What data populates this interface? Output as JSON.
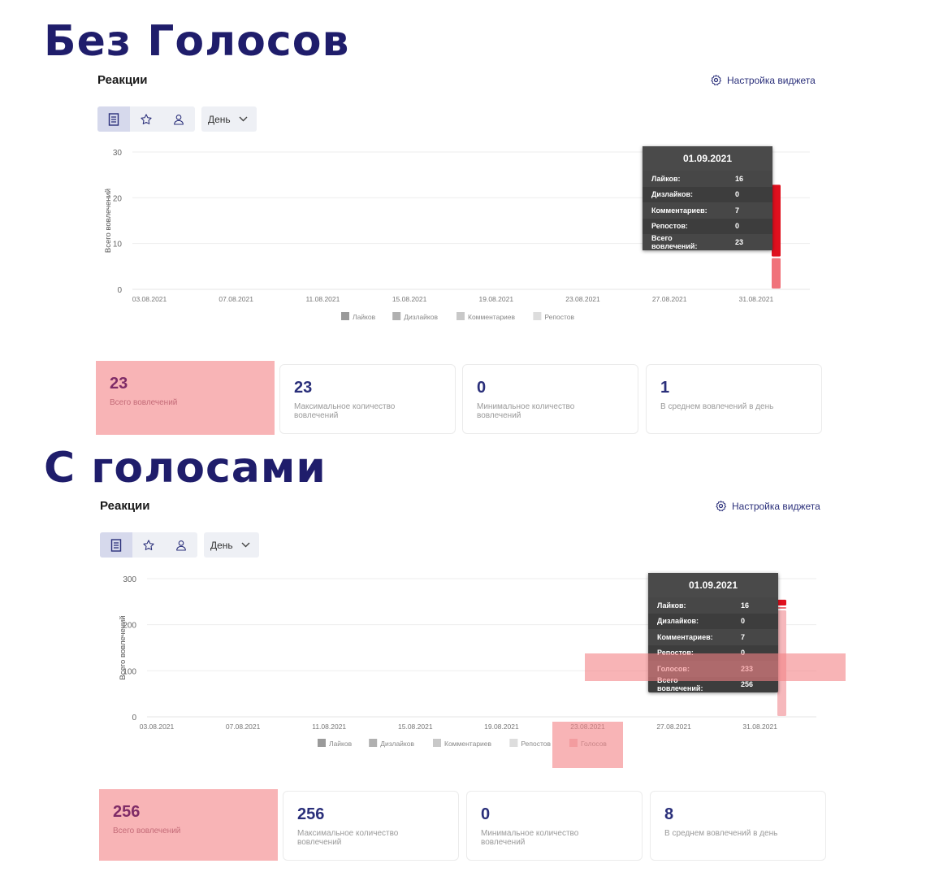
{
  "headings": {
    "without_votes": "Без Голосов",
    "with_votes": "С голосами"
  },
  "colors": {
    "heading": "#1f1d6b",
    "accent": "#2a2f7a",
    "bar_red": "#e0101e",
    "bar_pink": "#f0727a",
    "bar_light_pink": "#f6b8bc",
    "highlight": "#f38286"
  },
  "icons": {
    "settings": "gear-icon",
    "toolbar_1": "document-icon",
    "toolbar_2": "star-icon",
    "toolbar_3": "user-icon",
    "dropdown": "chevron-down-icon"
  },
  "widget1": {
    "title": "Реакции",
    "settings_label": "Настройка виджета",
    "period_select": "День",
    "tooltip": {
      "date": "01.09.2021",
      "rows": [
        {
          "label": "Лайков:",
          "value": "16"
        },
        {
          "label": "Дизлайков:",
          "value": "0"
        },
        {
          "label": "Комментариев:",
          "value": "7"
        },
        {
          "label": "Репостов:",
          "value": "0"
        },
        {
          "label": "Всего вовлечений:",
          "value": "23"
        }
      ]
    },
    "stats": [
      {
        "value": "23",
        "label": "Всего вовлечений"
      },
      {
        "value": "23",
        "label": "Максимальное количество вовлечений"
      },
      {
        "value": "0",
        "label": "Минимальное количество вовлечений"
      },
      {
        "value": "1",
        "label": "В среднем вовлечений в день"
      }
    ]
  },
  "widget2": {
    "title": "Реакции",
    "settings_label": "Настройка виджета",
    "period_select": "День",
    "tooltip": {
      "date": "01.09.2021",
      "rows": [
        {
          "label": "Лайков:",
          "value": "16"
        },
        {
          "label": "Дизлайков:",
          "value": "0"
        },
        {
          "label": "Комментариев:",
          "value": "7"
        },
        {
          "label": "Репостов:",
          "value": "0"
        },
        {
          "label": "Голосов:",
          "value": "233"
        },
        {
          "label": "Всего вовлечений:",
          "value": "256"
        }
      ]
    },
    "stats": [
      {
        "value": "256",
        "label": "Всего вовлечений"
      },
      {
        "value": "256",
        "label": "Максимальное количество вовлечений"
      },
      {
        "value": "0",
        "label": "Минимальное количество вовлечений"
      },
      {
        "value": "8",
        "label": "В среднем вовлечений в день"
      }
    ]
  },
  "chart_data": [
    {
      "type": "bar",
      "stacked": true,
      "ylabel": "Всего вовлечений",
      "xlabel": "",
      "ylim": [
        0,
        30
      ],
      "yticks": [
        0,
        10,
        20,
        30
      ],
      "xticks": [
        "03.08.2021",
        "07.08.2021",
        "11.08.2021",
        "15.08.2021",
        "19.08.2021",
        "23.08.2021",
        "27.08.2021",
        "31.08.2021"
      ],
      "categories": [
        "01.09.2021"
      ],
      "series": [
        {
          "name": "Лайков",
          "values": [
            16
          ],
          "color": "#e0101e"
        },
        {
          "name": "Дизлайков",
          "values": [
            0
          ],
          "color": "#b0b0b0"
        },
        {
          "name": "Комментариев",
          "values": [
            7
          ],
          "color": "#f0727a"
        },
        {
          "name": "Репостов",
          "values": [
            0
          ],
          "color": "#dddddd"
        }
      ],
      "legend_colors": [
        "#9a9a9a",
        "#b0b0b0",
        "#c8c8c8",
        "#dddddd"
      ],
      "grid": true,
      "legend_position": "bottom"
    },
    {
      "type": "bar",
      "stacked": true,
      "ylabel": "Всего вовлечений",
      "xlabel": "",
      "ylim": [
        0,
        300
      ],
      "yticks": [
        0,
        100,
        200,
        300
      ],
      "xticks": [
        "03.08.2021",
        "07.08.2021",
        "11.08.2021",
        "15.08.2021",
        "19.08.2021",
        "23.08.2021",
        "27.08.2021",
        "31.08.2021"
      ],
      "categories": [
        "01.09.2021"
      ],
      "series": [
        {
          "name": "Лайков",
          "values": [
            16
          ],
          "color": "#e0101e"
        },
        {
          "name": "Дизлайков",
          "values": [
            0
          ],
          "color": "#b0b0b0"
        },
        {
          "name": "Комментариев",
          "values": [
            7
          ],
          "color": "#f0727a"
        },
        {
          "name": "Репостов",
          "values": [
            0
          ],
          "color": "#dddddd"
        },
        {
          "name": "Голосов",
          "values": [
            233
          ],
          "color": "#f6b8bc"
        }
      ],
      "legend_colors": [
        "#9a9a9a",
        "#b0b0b0",
        "#c8c8c8",
        "#dddddd",
        "#f2c4c6"
      ],
      "grid": true,
      "legend_position": "bottom"
    }
  ]
}
